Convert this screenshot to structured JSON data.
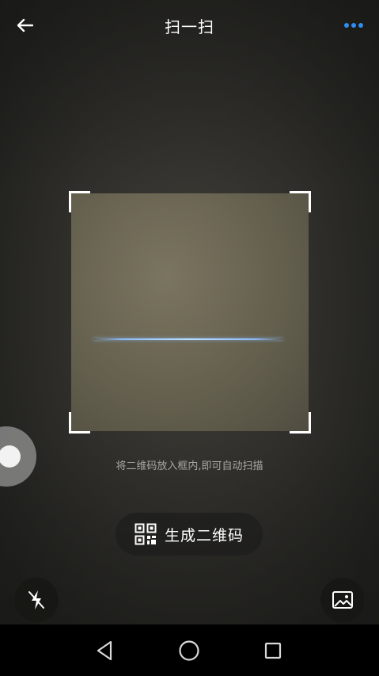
{
  "header": {
    "title": "扫一扫",
    "back_icon": "arrow-left-icon",
    "more_icon": "more-dots-icon",
    "more_color": "#2f8cf0"
  },
  "scanner": {
    "hint": "将二维码放入框内,即可自动扫描",
    "line_color": "#9cc8ff"
  },
  "actions": {
    "generate_qr_label": "生成二维码",
    "generate_qr_icon": "qr-code-icon",
    "flash_icon": "flash-off-icon",
    "album_icon": "image-icon"
  },
  "system_nav": {
    "back_icon": "triangle-back-icon",
    "home_icon": "circle-home-icon",
    "recent_icon": "square-recent-icon"
  }
}
